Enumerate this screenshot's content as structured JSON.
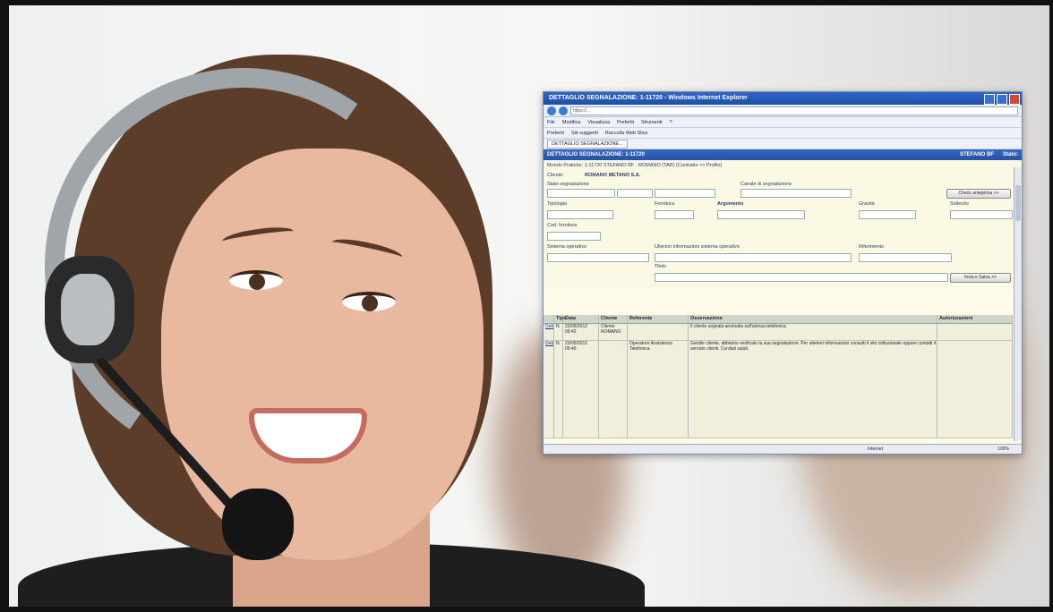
{
  "browser": {
    "title": "DETTAGLIO SEGNALAZIONE: 1-11720 - Windows Internet Explorer",
    "url": "https://...",
    "menu": [
      "File",
      "Modifica",
      "Visualizza",
      "Preferiti",
      "Strumenti",
      "?"
    ],
    "favorites": [
      "Preferiti",
      "Siti suggeriti",
      "Raccolta Web Slice"
    ],
    "tab": "DETTAGLIO SEGNALAZIONE...",
    "status": "Internet",
    "zoom": "100%"
  },
  "app": {
    "header_title": "DETTAGLIO SEGNALAZIONE: 1-11720",
    "header_right": "STEFANO BF",
    "header_far_right": "Stato:"
  },
  "form": {
    "line1": "Mondo Pratiche: 1-11720 STEFANO BF - ROMANO (TAR) (Contratto >> Profilo)",
    "line2_label": "Cliente:",
    "line2_value": "ROMANO METANO S.A.",
    "stato": "Stato segnalazione",
    "canale": "Canale di segnalazione",
    "tipologia": "Tipologia",
    "fornitura": "Fornitura",
    "argomento": "Argomento",
    "gravita": "Gravità",
    "sollecito": "Sollecito",
    "cod_fornitura": "Cod. fornitura",
    "sistema_operativo": "Sistema operativo",
    "ulteriori": "Ulteriori informazioni sistema operativo",
    "riferimento": "Riferimento",
    "titolo": "Titolo",
    "btn_check": "Check anteprima >>",
    "btn_save": "Invia e Salva >>"
  },
  "grid": {
    "headers": [
      "",
      "Tipo",
      "Data",
      "Cliente",
      "Referente",
      "Osservazione",
      "Autorizzazioni"
    ],
    "rows": [
      {
        "id": "Dett",
        "tipo": "N",
        "data": "23/05/2012 09:42",
        "cliente": "Cliente ROMANO",
        "referente": "",
        "note": "Il cliente segnala anomalia sull'utenza telefonica."
      },
      {
        "id": "Dett",
        "tipo": "N",
        "data": "23/05/2012 09:45",
        "cliente": "",
        "referente": "Operatore Assistenza Telefonica",
        "note": "Gentile cliente, abbiamo verificato la sua segnalazione. Per ulteriori informazioni consulti il sito istituzionale oppure contatti il servizio clienti. Cordiali saluti."
      }
    ]
  }
}
